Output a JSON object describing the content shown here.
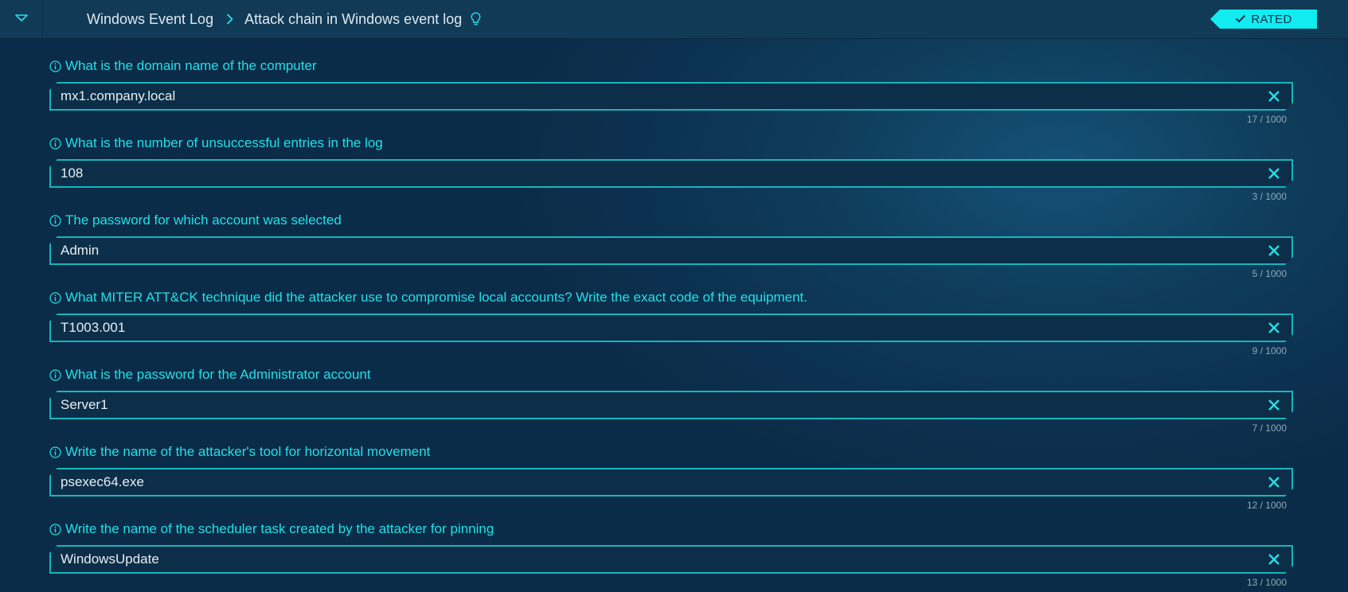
{
  "header": {
    "breadcrumb_parent": "Windows Event Log",
    "breadcrumb_current": "Attack chain in Windows event log",
    "status_badge": "RATED"
  },
  "colors": {
    "accent": "#10ecf0",
    "label": "#24dfe6",
    "field_border": "#15b6be",
    "background": "#0f3d5c"
  },
  "icons": {
    "collapse": "caret-down-icon",
    "breadcrumb_separator": "chevron-right-icon",
    "hint": "lightbulb-icon",
    "badge": "check-icon",
    "label": "info-icon",
    "clear": "close-icon"
  },
  "questions": [
    {
      "label": "What is the domain name of the computer",
      "value": "mx1.company.local",
      "count": "17 / 1000"
    },
    {
      "label": "What is the number of unsuccessful entries in the log",
      "value": "108",
      "count": "3 / 1000"
    },
    {
      "label": "The password for which account was selected",
      "value": "Admin",
      "count": "5 / 1000"
    },
    {
      "label": "What MITER ATT&CK technique did the attacker use to compromise local accounts? Write the exact code of the equipment.",
      "value": "T1003.001",
      "count": "9 / 1000"
    },
    {
      "label": "What is the password for the Administrator account",
      "value": "Server1",
      "count": "7 / 1000"
    },
    {
      "label": "Write the name of the attacker's tool for horizontal movement",
      "value": "psexec64.exe",
      "count": "12 / 1000"
    },
    {
      "label": "Write the name of the scheduler task created by the attacker for pinning",
      "value": "WindowsUpdate",
      "count": "13 / 1000"
    }
  ]
}
